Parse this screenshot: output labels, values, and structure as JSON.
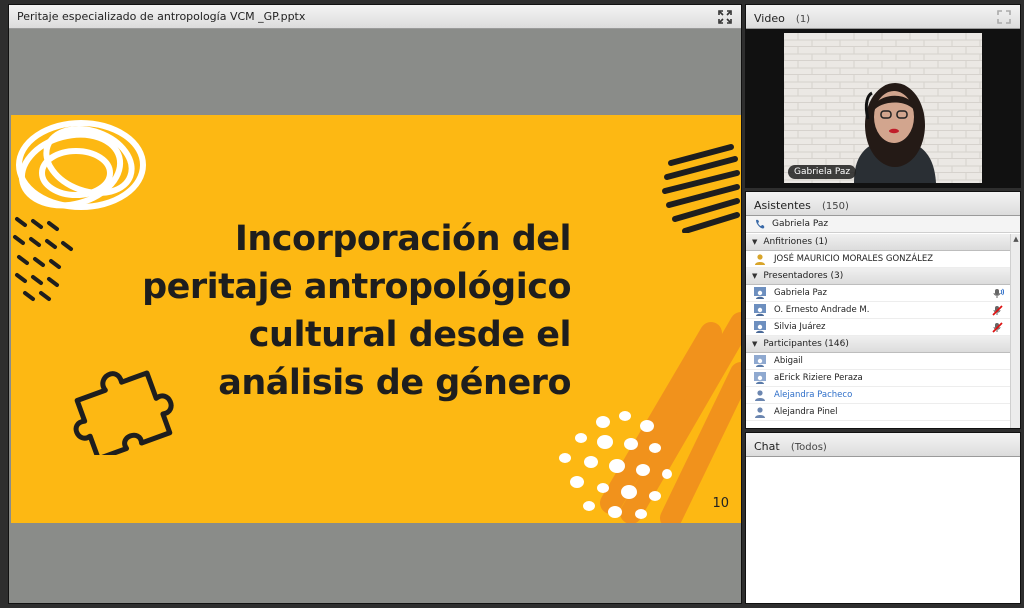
{
  "share": {
    "title": "Peritaje especializado de antropología VCM _GP.pptx",
    "slide": {
      "lines": [
        "Incorporación del",
        "peritaje antropológico",
        "cultural desde el",
        "análisis de género"
      ],
      "number": "10"
    }
  },
  "video": {
    "title": "Video",
    "count": "(1)",
    "name_tag": "Gabriela Paz"
  },
  "attendees": {
    "title": "Asistentes",
    "count": "(150)",
    "presenter": "Gabriela Paz",
    "hosts": {
      "label": "Anfitriones (1)",
      "members": [
        "JOSÉ MAURICIO MORALES GONZÁLEZ"
      ]
    },
    "presenters": {
      "label": "Presentadores (3)",
      "members": [
        "Gabriela Paz",
        "O. Ernesto Andrade M.",
        "Silvia Juárez"
      ]
    },
    "participants": {
      "label": "Participantes (146)",
      "members": [
        "Abigail",
        "aErick Riziere Peraza",
        "Alejandra Pacheco",
        "Alejandra Pinel"
      ]
    }
  },
  "chat": {
    "title": "Chat",
    "scope": "(Todos)"
  },
  "colors": {
    "slide_bg": "#fdb813",
    "slide_text": "#1e1e1e",
    "share_bg": "#8a8c89",
    "link_blue": "#2f6fc9"
  }
}
